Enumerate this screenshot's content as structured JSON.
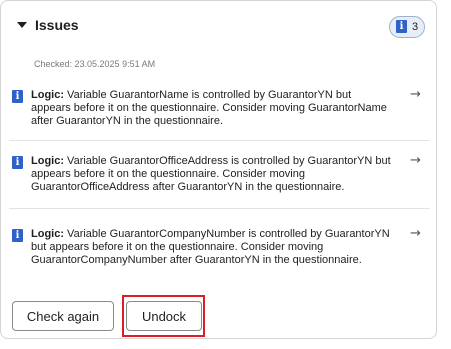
{
  "header": {
    "title": "Issues",
    "toggle_icon": "caret-down-icon",
    "badge": {
      "icon": "info-icon",
      "icon_glyph": "i",
      "count": "3"
    }
  },
  "checked_label": "Checked: 23.05.2025 9:51 AM",
  "issues": [
    {
      "icon": "info-icon",
      "icon_glyph": "i",
      "kind": "Logic:",
      "message": " Variable GuarantorName is controlled by GuarantorYN but appears before it on the questionnaire. Consider moving GuarantorName after GuarantorYN in the questionnaire.",
      "arrow": "→"
    },
    {
      "icon": "info-icon",
      "icon_glyph": "i",
      "kind": "Logic:",
      "message": " Variable GuarantorOfficeAddress is controlled by GuarantorYN but appears before it on the questionnaire. Consider moving GuarantorOfficeAddress after GuarantorYN in the questionnaire.",
      "arrow": "→"
    },
    {
      "icon": "info-icon",
      "icon_glyph": "i",
      "kind": "Logic:",
      "message": " Variable GuarantorCompanyNumber is controlled by GuarantorYN but appears before it on the questionnaire. Consider moving GuarantorCompanyNumber after GuarantorYN in the questionnaire.",
      "arrow": "→"
    }
  ],
  "buttons": {
    "check_again": "Check again",
    "undock": "Undock"
  },
  "colors": {
    "info_icon": "#2f62c9",
    "badge_background": "#e8eef7",
    "highlight": "#d91f26"
  }
}
